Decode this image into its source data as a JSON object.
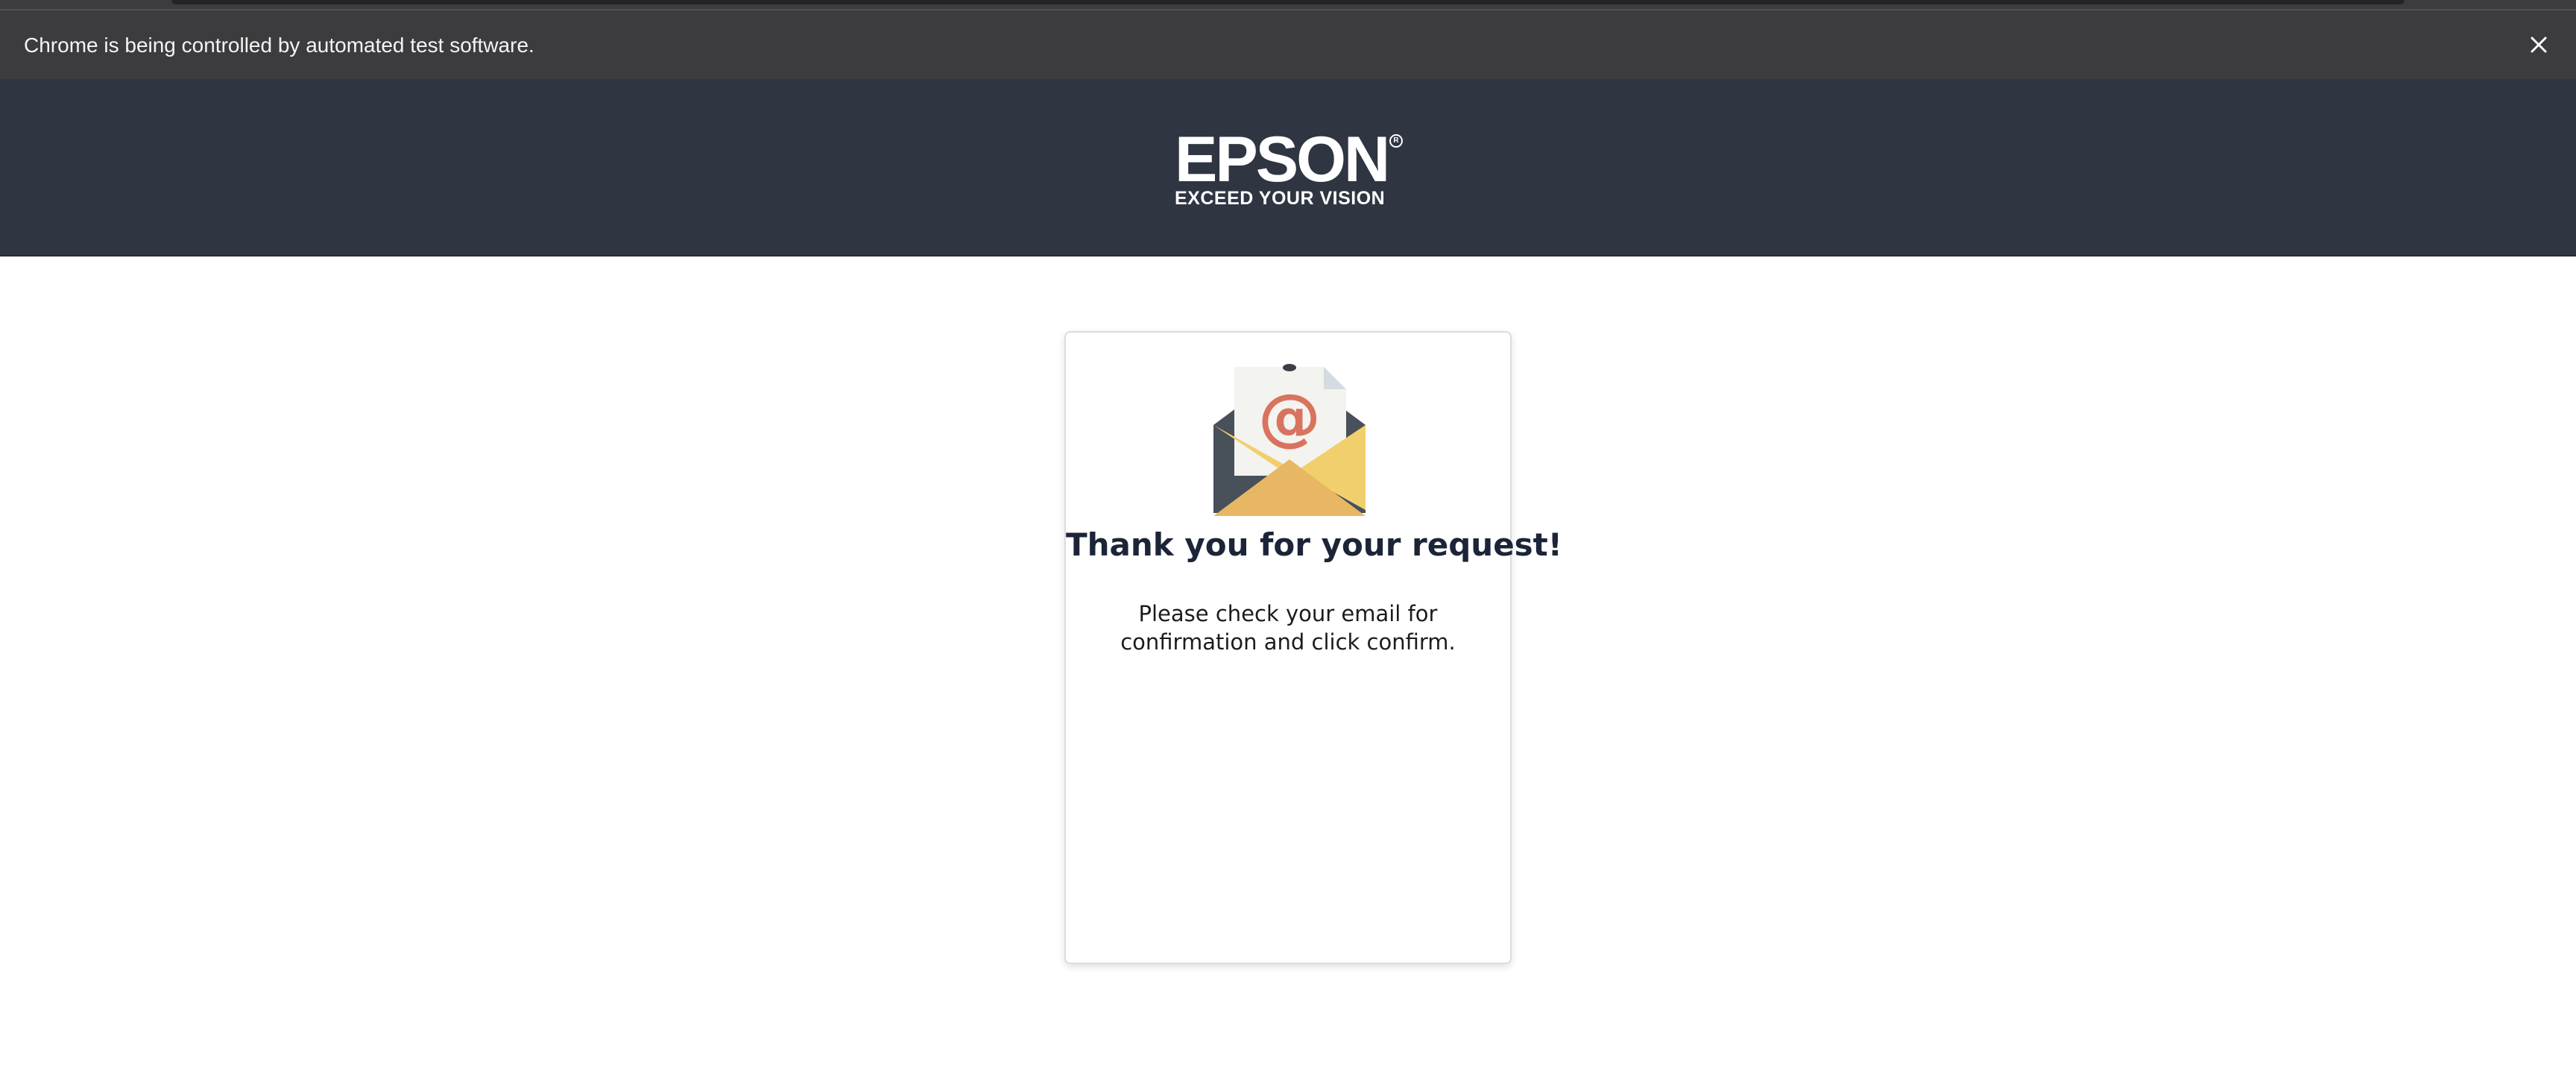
{
  "browser": {
    "automation_notice": "Chrome is being controlled by automated test software.",
    "close_icon": "close-icon"
  },
  "header": {
    "logo_word": "EPSON",
    "logo_tagline": "EXCEED YOUR VISION",
    "registered_mark": "R",
    "background_color": "#2f3541"
  },
  "confirmation_card": {
    "icon": "envelope-email-icon",
    "icon_symbol": "@",
    "title": "Thank you for your request!",
    "message": "Please check your email for confirmation and click confirm."
  }
}
